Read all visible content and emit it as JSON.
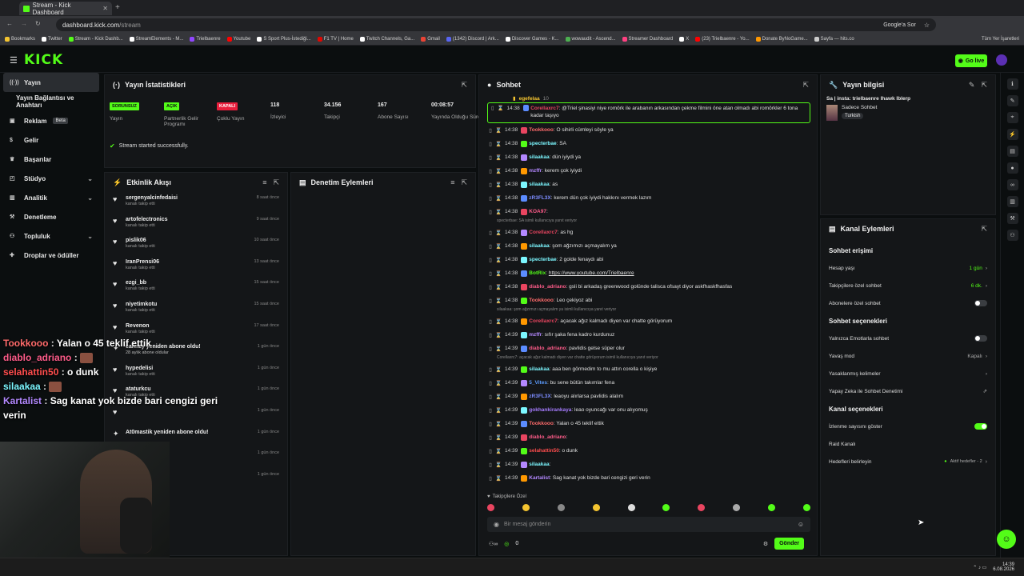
{
  "browser": {
    "tab_title": "Stream - Kick Dashboard",
    "url_host": "dashboard.kick.com",
    "url_path": "/stream",
    "google_search": "Google'a Sor",
    "bookmarks": [
      {
        "label": "Bookmarks",
        "color": "#f4c430"
      },
      {
        "label": "Twitter",
        "color": "#ffffff"
      },
      {
        "label": "Stream - Kick Dashb...",
        "color": "#53fc18"
      },
      {
        "label": "StreamElements - M...",
        "color": "#ffffff"
      },
      {
        "label": "Trielbaenre",
        "color": "#9146ff"
      },
      {
        "label": "Youtube",
        "color": "#ff0000"
      },
      {
        "label": "S Sport Plus-İstediği...",
        "color": "#ffffff"
      },
      {
        "label": "F1 TV | Home",
        "color": "#e10600"
      },
      {
        "label": "Twitch Channels, Ga...",
        "color": "#ffffff"
      },
      {
        "label": "Gmail",
        "color": "#ea4335"
      },
      {
        "label": "(1342) Discord | Ark...",
        "color": "#5865f2"
      },
      {
        "label": "Discover Games - K...",
        "color": "#ffffff"
      },
      {
        "label": "wowaudit - Ascend...",
        "color": "#4caf50"
      },
      {
        "label": "Streamer Dashboard",
        "color": "#ff4081"
      },
      {
        "label": "X",
        "color": "#ffffff"
      },
      {
        "label": "(23) Trielbaenre - Yo...",
        "color": "#ff0000"
      },
      {
        "label": "Donate ByNoGame...",
        "color": "#ff9800"
      },
      {
        "label": "Sayfa — hits.co",
        "color": "#cccccc"
      }
    ],
    "all_bookmarks": "Tüm Yer İşaretleri"
  },
  "header": {
    "logo": "KICK",
    "go_live": "Go live"
  },
  "sidebar": {
    "items": [
      {
        "label": "Yayın",
        "icon": "broadcast-icon",
        "active": true
      },
      {
        "label": "Yayın Bağlantısı ve Anahtarı",
        "icon": "",
        "active": false
      },
      {
        "label": "Reklam",
        "icon": "ad-icon",
        "badge": "Beta"
      },
      {
        "label": "Gelir",
        "icon": "dollar-icon"
      },
      {
        "label": "Başarılar",
        "icon": "trophy-icon"
      },
      {
        "label": "Stüdyo",
        "icon": "studio-icon",
        "caret": true
      },
      {
        "label": "Analitik",
        "icon": "chart-icon",
        "caret": true
      },
      {
        "label": "Denetleme",
        "icon": "hammer-icon"
      },
      {
        "label": "Topluluk",
        "icon": "users-icon",
        "caret": true
      },
      {
        "label": "Droplar ve ödüller",
        "icon": "gift-icon"
      }
    ]
  },
  "stats": {
    "title": "Yayın İstatistikleri",
    "items": [
      {
        "badge": "SORUNSUZ",
        "badge_color": "#53fc18",
        "label": "Yayın"
      },
      {
        "badge": "AÇIK",
        "badge_color": "#53fc18",
        "label": "Partnerlik Gelir Programı"
      },
      {
        "badge": "KAPALI",
        "badge_color": "#e91e3c",
        "label": "Çoklu Yayın"
      },
      {
        "value": "118",
        "label": "İzleyici"
      },
      {
        "value": "34.156",
        "label": "Takipçi"
      },
      {
        "value": "167",
        "label": "Abone Sayısı"
      },
      {
        "value": "00:08:57",
        "label": "Yayında Olduğu Süre"
      }
    ],
    "status": "Stream started successfully."
  },
  "activity": {
    "title": "Etkinlik Akışı",
    "items": [
      {
        "name": "sergenyalcinfedaisi",
        "sub": "kanalı takip etti",
        "time": "8 saat önce"
      },
      {
        "name": "artofelectronics",
        "sub": "kanalı takip etti",
        "time": "9 saat önce"
      },
      {
        "name": "pislik06",
        "sub": "kanalı takip etti",
        "time": "10 saat önce"
      },
      {
        "name": "IranPrensi06",
        "sub": "kanalı takip etti",
        "time": "13 saat önce"
      },
      {
        "name": "ezgi_bb",
        "sub": "kanalı takip etti",
        "time": "15 saat önce"
      },
      {
        "name": "niyetimkotu",
        "sub": "kanalı takip etti",
        "time": "15 saat önce"
      },
      {
        "name": "Revenon",
        "sub": "kanalı takip etti",
        "time": "17 saat önce"
      },
      {
        "name": "cannzy yeniden abone oldu!",
        "sub": "28 aylık abone oldular",
        "time": "1 gün önce"
      },
      {
        "name": "hypedelisi",
        "sub": "kanalı takip etti",
        "time": "1 gün önce"
      },
      {
        "name": "ataturkcu",
        "sub": "kanalı takip etti",
        "time": "1 gün önce"
      },
      {
        "name": "",
        "sub": "",
        "time": "1 gün önce"
      },
      {
        "name": "At0mastik yeniden abone oldu!",
        "sub": "",
        "time": "1 gün önce"
      },
      {
        "name": "",
        "sub": "",
        "time": "1 gün önce"
      },
      {
        "name": "",
        "sub": "",
        "time": "1 gün önce"
      }
    ]
  },
  "moderation": {
    "title": "Denetim Eylemleri"
  },
  "chat": {
    "title": "Sohbet",
    "pinned_user": "egefelaa",
    "pinned_count": "10",
    "messages": [
      {
        "time": "14:38",
        "user": "Corellaxrc7",
        "color": "#e94560",
        "text": "@Triel şinasiyi niye romörk ile arabanın arkasından çekme filmini öne atan olmadı abi romörkler 6 tona kadar taşıyo",
        "highlight": true
      },
      {
        "time": "14:38",
        "user": "Tookkooo",
        "color": "#ff6b6b",
        "text": "O sihirli cümleyi söyle ya"
      },
      {
        "time": "14:38",
        "user": "specterbae",
        "color": "#7cf7ff",
        "text": "SA"
      },
      {
        "time": "14:38",
        "user": "silaakaa",
        "color": "#7cf7ff",
        "text": "dün iyiydi ya"
      },
      {
        "time": "14:38",
        "user": "mzffr",
        "color": "#b388ff",
        "text": "kerem çok iyiydi"
      },
      {
        "time": "14:38",
        "user": "silaakaa",
        "color": "#7cf7ff",
        "text": "as"
      },
      {
        "time": "14:38",
        "user": "zR3FL3X",
        "color": "#7c8cff",
        "text": "kerem dün çok iyiydi hakkını vermek lazım"
      },
      {
        "time": "14:38",
        "user": "KOA97",
        "color": "#ff5c8a",
        "text": ""
      },
      {
        "reply": "specterbae: SA isimli kullanıcıya yanıt veriyor"
      },
      {
        "time": "14:38",
        "user": "Corellaxrc7",
        "color": "#e94560",
        "text": "as hg"
      },
      {
        "time": "14:38",
        "user": "silaakaa",
        "color": "#7cf7ff",
        "text": "şom ağzımızı açmayalım ya"
      },
      {
        "time": "14:38",
        "user": "specterbae",
        "color": "#7cf7ff",
        "text": "2 golde fenaydı abi"
      },
      {
        "time": "14:38",
        "user": "BotRix",
        "color": "#53fc18",
        "text": "https://www.youtube.com/Trielbaenre"
      },
      {
        "time": "14:38",
        "user": "diablo_adriano",
        "color": "#ff5c8a",
        "text": "gsli bi arkadaş greenwood golünde talisca ofsayt diyor askfhaskfhasfas"
      },
      {
        "time": "14:38",
        "user": "Tookkooo",
        "color": "#ff6b6b",
        "text": "Leo çekiyoz abi"
      },
      {
        "reply": "silaakaa: şom ağzımızı açmayalım ya isimli kullanıcıya yanıt veriyor"
      },
      {
        "time": "14:38",
        "user": "Corellaxrc7",
        "color": "#e94560",
        "text": "açacak ağız kalmadı diyen var chatte görüyorum"
      },
      {
        "time": "14:39",
        "user": "mzffr",
        "color": "#b388ff",
        "text": "sıfır şaka fena kadro kurdunuz"
      },
      {
        "time": "14:39",
        "user": "diablo_adriano",
        "color": "#ff5c8a",
        "text": "pavlidis gelse süper olur"
      },
      {
        "reply": "Corellaxrc7: açacak ağız kalmadı diyen var chatte görüyorum isimli kullanıcıya yanıt veriyor"
      },
      {
        "time": "14:39",
        "user": "silaakaa",
        "color": "#7cf7ff",
        "text": "aaa ben görmedim to mu attın corella o kişiye"
      },
      {
        "time": "14:39",
        "user": "5_Vites",
        "color": "#5c9cff",
        "text": "bu sene bütün takımlar fena"
      },
      {
        "time": "14:39",
        "user": "zR3FL3X",
        "color": "#7c8cff",
        "text": "leaoyu alırlarsa pavlidis alalım"
      },
      {
        "time": "14:39",
        "user": "gokhankirankaya",
        "color": "#a67cff",
        "text": "leao oyuncağı var onu alıyomuş"
      },
      {
        "time": "14:39",
        "user": "Tookkooo",
        "color": "#ff6b6b",
        "text": "Yalan o 45 teklif ettik"
      },
      {
        "time": "14:39",
        "user": "diablo_adriano",
        "color": "#ff5c8a",
        "text": ""
      },
      {
        "time": "14:39",
        "user": "selahattin50",
        "color": "#ff4d4d",
        "text": "o dunk"
      },
      {
        "time": "14:39",
        "user": "silaakaa",
        "color": "#7cf7ff",
        "text": ""
      },
      {
        "time": "14:39",
        "user": "Kartalist",
        "color": "#b388ff",
        "text": "Sag kanat yok bizde bari cengizi geri verin"
      }
    ],
    "followers_only": "Takipçilere Özel",
    "input_placeholder": "Bir mesaj gönderin",
    "count": "0",
    "send": "Gönder"
  },
  "stream_info": {
    "title": "Yayın bilgisi",
    "stream_title": "Sa | insta: trielbaenre lhawk lblerp",
    "category": "Sadece Sohbet",
    "language": "Turkish"
  },
  "channel_actions": {
    "title": "Kanal Eylemleri",
    "chat_access": "Sohbet erişimi",
    "account_age": {
      "label": "Hesap yaşı",
      "value": "1 gün"
    },
    "follower_chat": {
      "label": "Takipçilere özel sohbet",
      "value": "6 dk."
    },
    "sub_chat": {
      "label": "Abonelere özel sohbet"
    },
    "chat_options": "Sohbet seçenekleri",
    "emote_only": {
      "label": "Yalnızca Emotlarla sohbet"
    },
    "slow_mode": {
      "label": "Yavaş mod",
      "value": "Kapalı"
    },
    "banned_words": {
      "label": "Yasaklanmış kelimeler"
    },
    "ai_mod": {
      "label": "Yapay Zeka ile Sohbet Denetimi"
    },
    "channel_options": "Kanal seçenekleri",
    "show_viewers": {
      "label": "İzlenme sayısını göster"
    },
    "raid": {
      "label": "Raid Kanalı"
    },
    "goals": {
      "label": "Hedefleri belirleyin",
      "value": "Aktif hedefler - 2"
    }
  },
  "overlay": {
    "lines": [
      {
        "user": "Tookkooo",
        "color": "#ff6b6b",
        "text": "Yalan o 45 teklif ettik"
      },
      {
        "user": "diablo_adriano",
        "color": "#ff5c8a",
        "text": ""
      },
      {
        "user": "selahattin50",
        "color": "#ff4d4d",
        "text": "o dunk"
      },
      {
        "user": "silaakaa",
        "color": "#7cf7ff",
        "text": ""
      },
      {
        "user": "Kartalist",
        "color": "#b388ff",
        "text": "Sag kanat yok bizde bari cengizi geri verin"
      }
    ]
  },
  "taskbar": {
    "time": "14:39",
    "date": "6.08.2026"
  }
}
